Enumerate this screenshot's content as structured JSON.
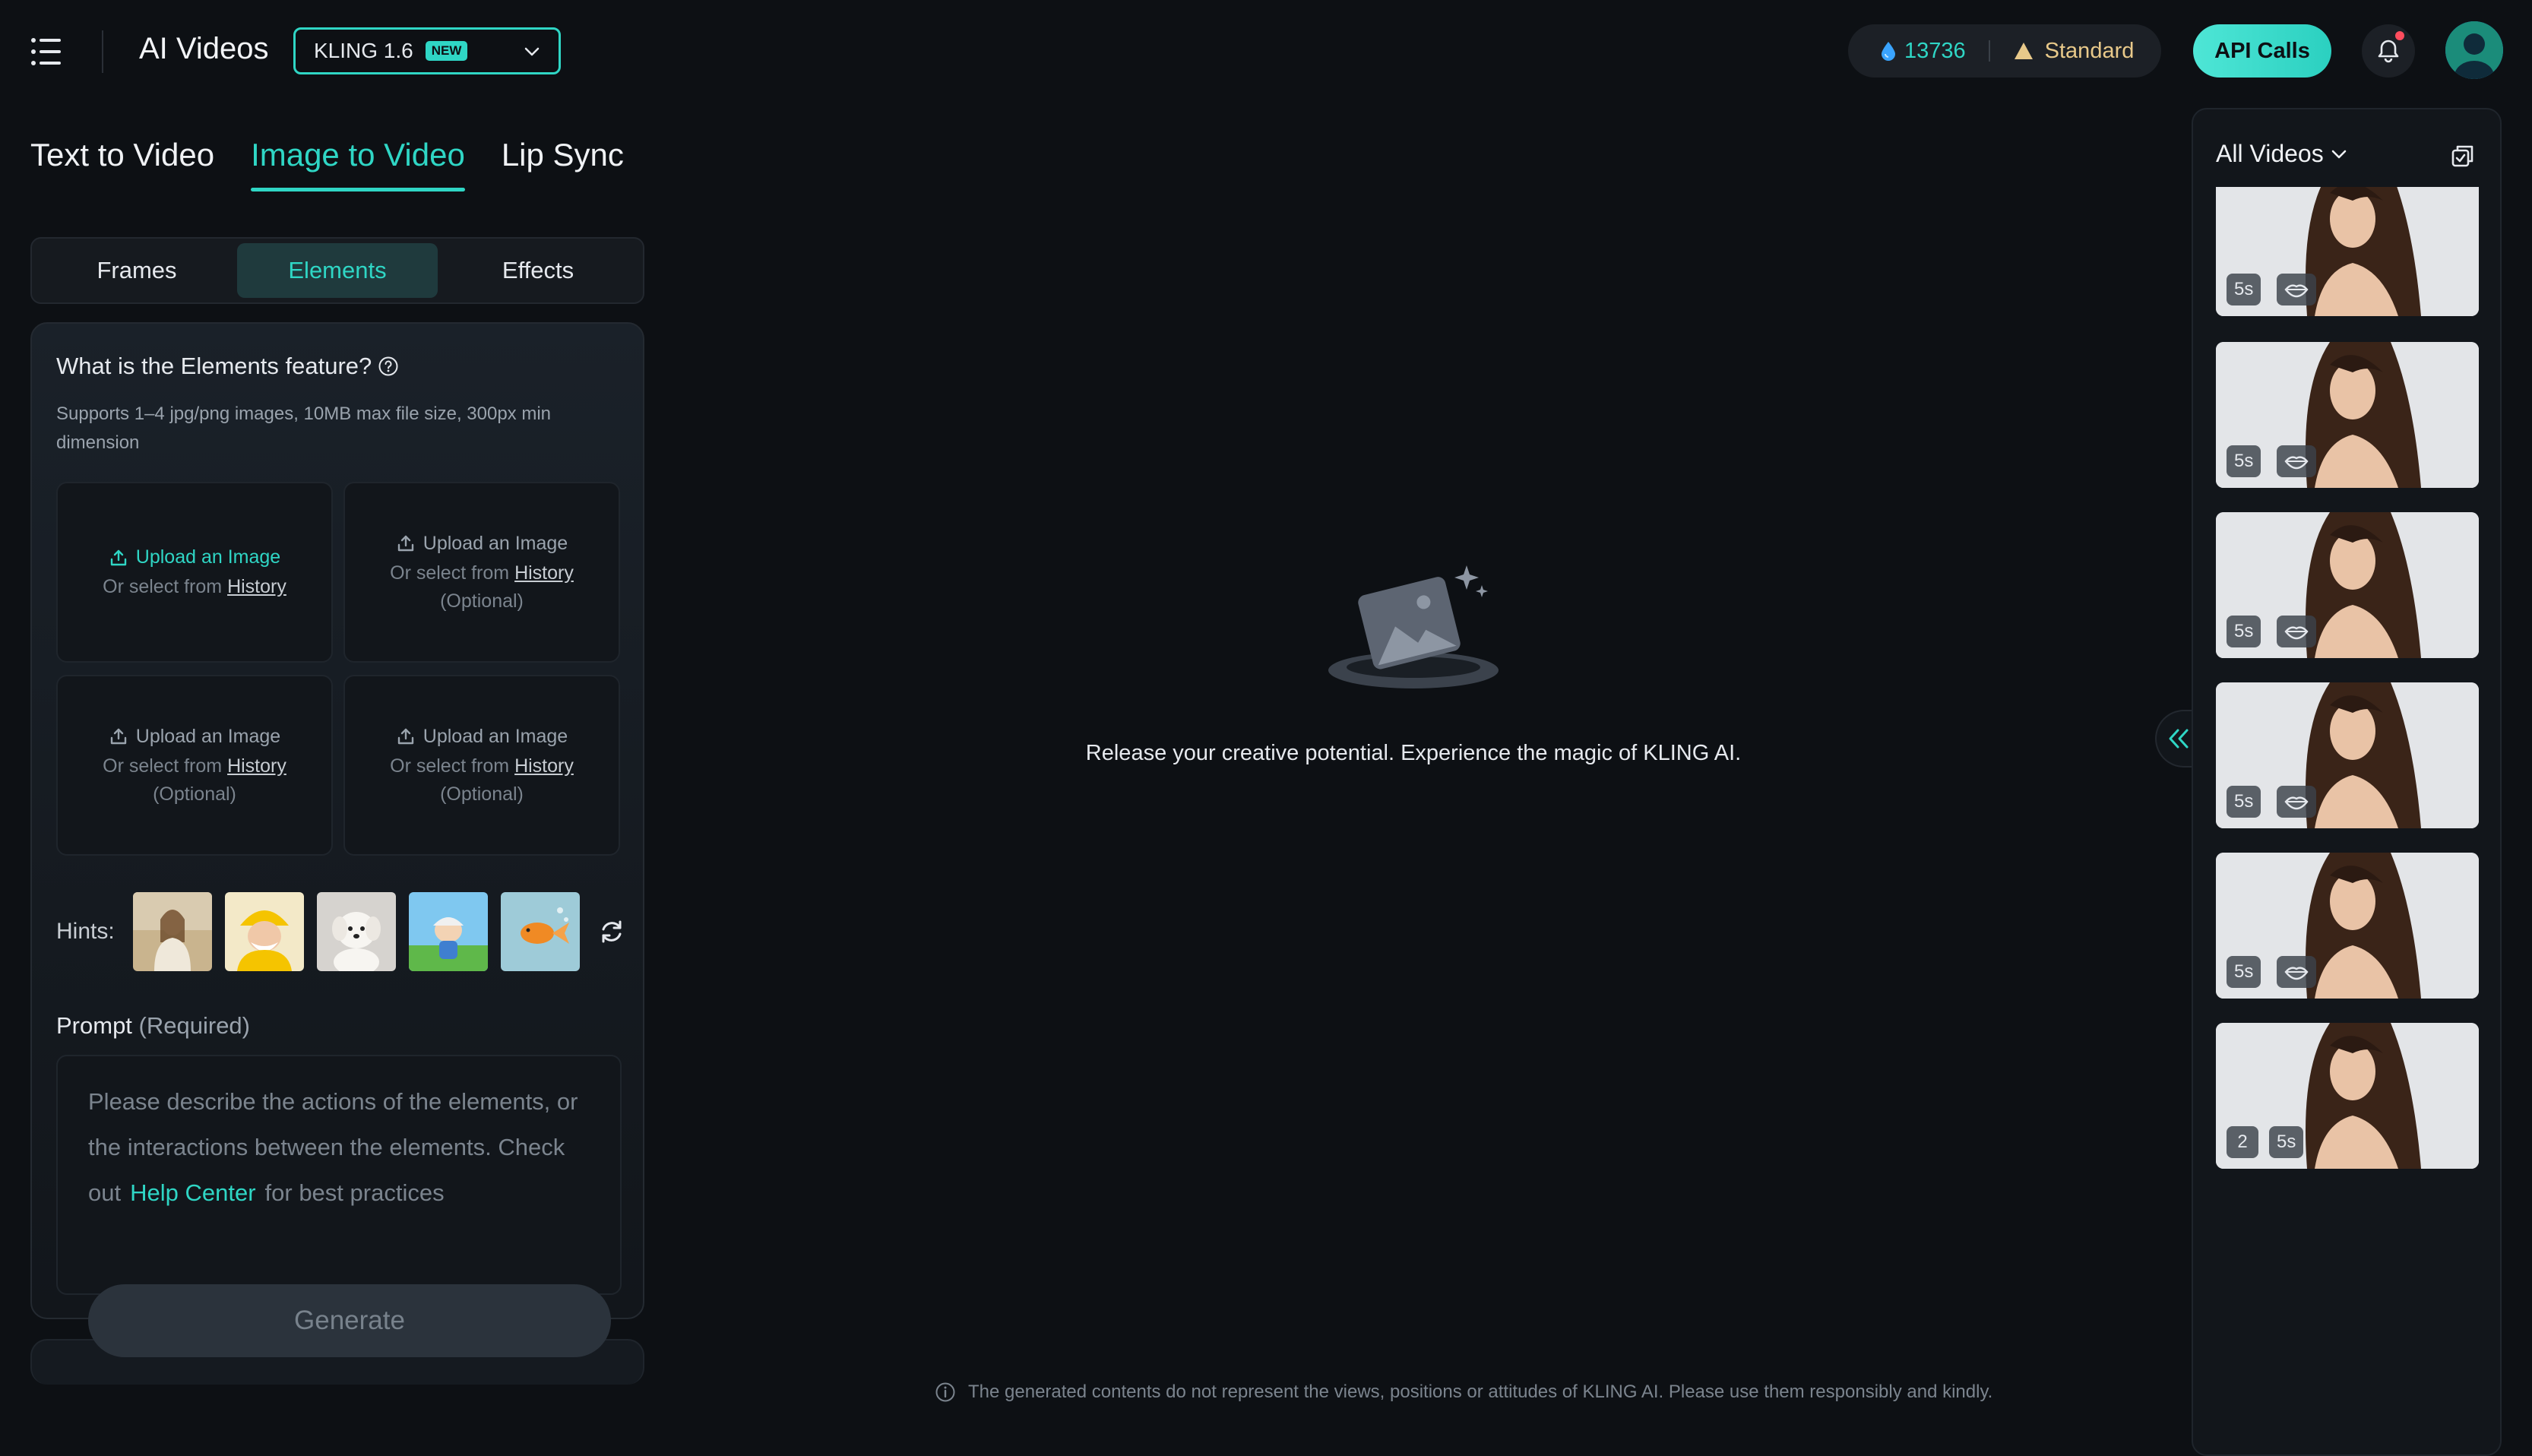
{
  "header": {
    "app_title": "AI Videos",
    "model": {
      "name": "KLING 1.6",
      "badge": "NEW"
    },
    "credits": "13736",
    "plan": "Standard",
    "api_button": "API Calls"
  },
  "mode_tabs": [
    {
      "label": "Text to Video",
      "active": false
    },
    {
      "label": "Image to Video",
      "active": true
    },
    {
      "label": "Lip Sync",
      "active": false
    }
  ],
  "sub_tabs": [
    {
      "label": "Frames",
      "active": false
    },
    {
      "label": "Elements",
      "active": true
    },
    {
      "label": "Effects",
      "active": false
    }
  ],
  "elements": {
    "title": "What is the Elements feature?",
    "description": "Supports 1–4 jpg/png images, 10MB max file size, 300px min dimension",
    "slots": [
      {
        "upload": "Upload an Image",
        "select_prefix": "Or select from",
        "history": "History",
        "optional": ""
      },
      {
        "upload": "Upload an Image",
        "select_prefix": "Or select from",
        "history": "History",
        "optional": "(Optional)"
      },
      {
        "upload": "Upload an Image",
        "select_prefix": "Or select from",
        "history": "History",
        "optional": "(Optional)"
      },
      {
        "upload": "Upload an Image",
        "select_prefix": "Or select from",
        "history": "History",
        "optional": "(Optional)"
      }
    ],
    "hints_label": "Hints:",
    "prompt_label": "Prompt",
    "prompt_required": "(Required)",
    "prompt_placeholder_pre": "Please describe the actions of the elements, or the interactions between the elements. Check out",
    "prompt_help_link": "Help Center",
    "prompt_placeholder_post": "for best practices",
    "generate": "Generate"
  },
  "center": {
    "empty_message": "Release your creative potential. Experience the magic of KLING AI.",
    "disclaimer": "The generated contents do not represent the views, positions or attitudes of KLING AI. Please use them responsibly and kindly."
  },
  "right_panel": {
    "filter": "All Videos",
    "videos": [
      {
        "duration": "5s",
        "count": ""
      },
      {
        "duration": "5s",
        "count": ""
      },
      {
        "duration": "5s",
        "count": ""
      },
      {
        "duration": "5s",
        "count": ""
      },
      {
        "duration": "5s",
        "count": ""
      },
      {
        "duration": "5s",
        "count": "2"
      }
    ]
  },
  "colors": {
    "accent": "#2fd6c5",
    "background": "#0d1014",
    "plan": "#e8c98a"
  }
}
